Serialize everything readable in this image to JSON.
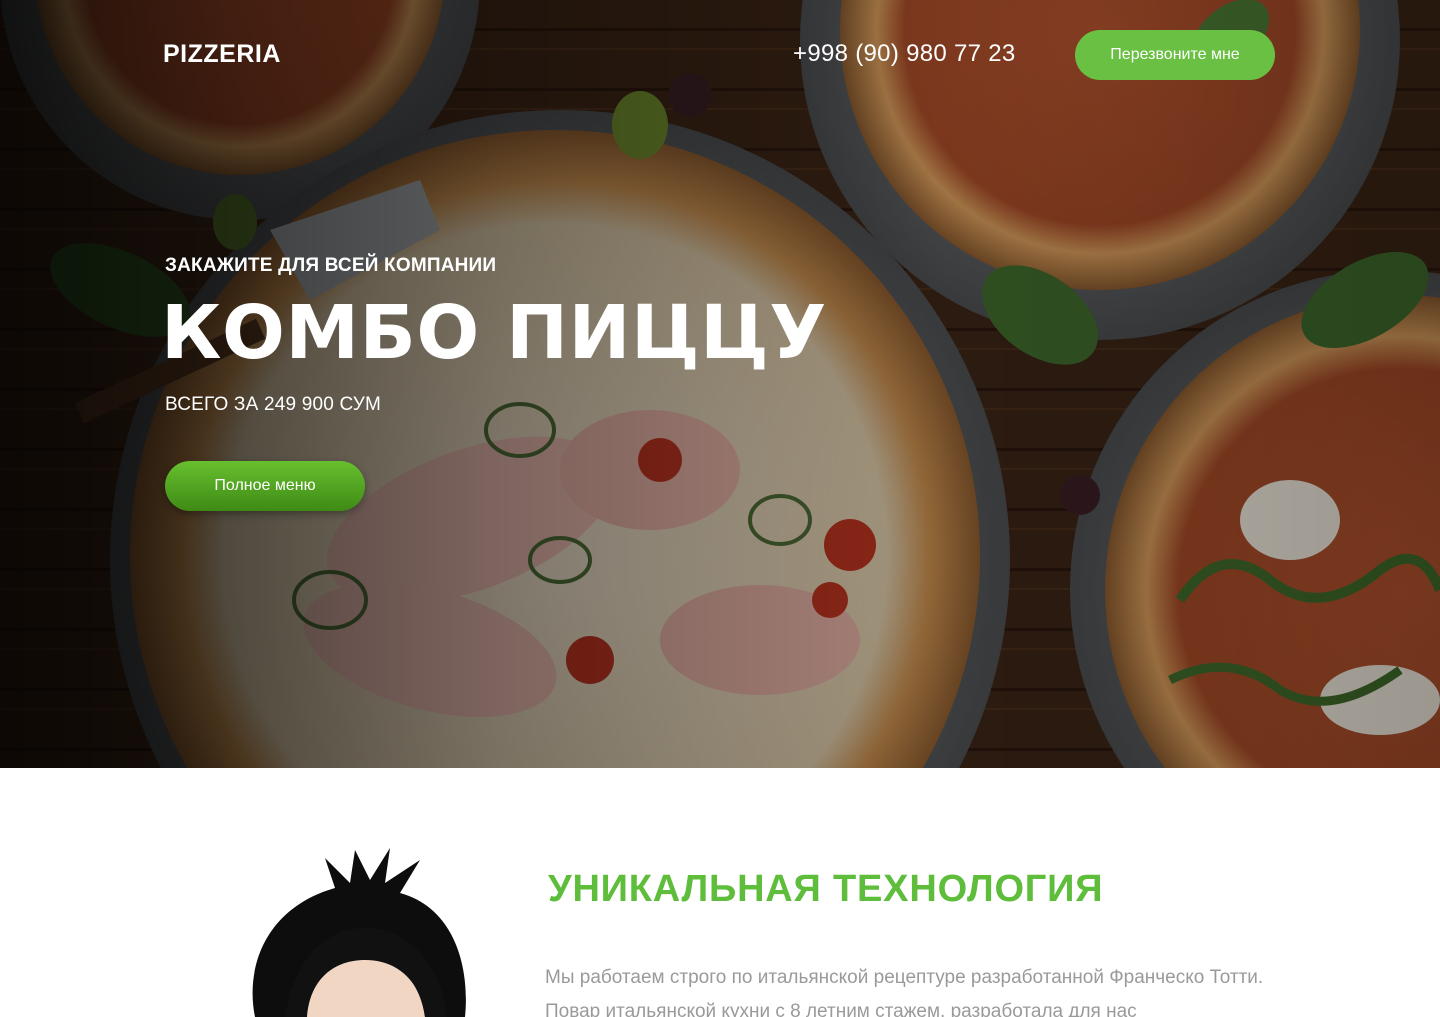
{
  "header": {
    "logo": "PIZZERIA",
    "phone": "+998 (90) 980 77 23",
    "callback_label": "Перезвоните мне"
  },
  "hero": {
    "eyebrow": "ЗАКАЖИТЕ ДЛЯ ВСЕЙ КОМПАНИИ",
    "headline": "КОМБО ПИЦЦУ",
    "price": "ВСЕГО ЗА 249 900 СУМ",
    "menu_button_label": "Полное меню"
  },
  "about": {
    "title": "УНИКАЛЬНАЯ ТЕХНОЛОГИЯ",
    "text": "Мы работаем строго по итальянской рецептуре разработанной Франческо Тотти. Повар итальянской кухни с 8 летним стажем, разработала для нас"
  },
  "colors": {
    "accent": "#69c043",
    "title_green": "#5ebd3a",
    "body_text": "#9a9a9a"
  }
}
